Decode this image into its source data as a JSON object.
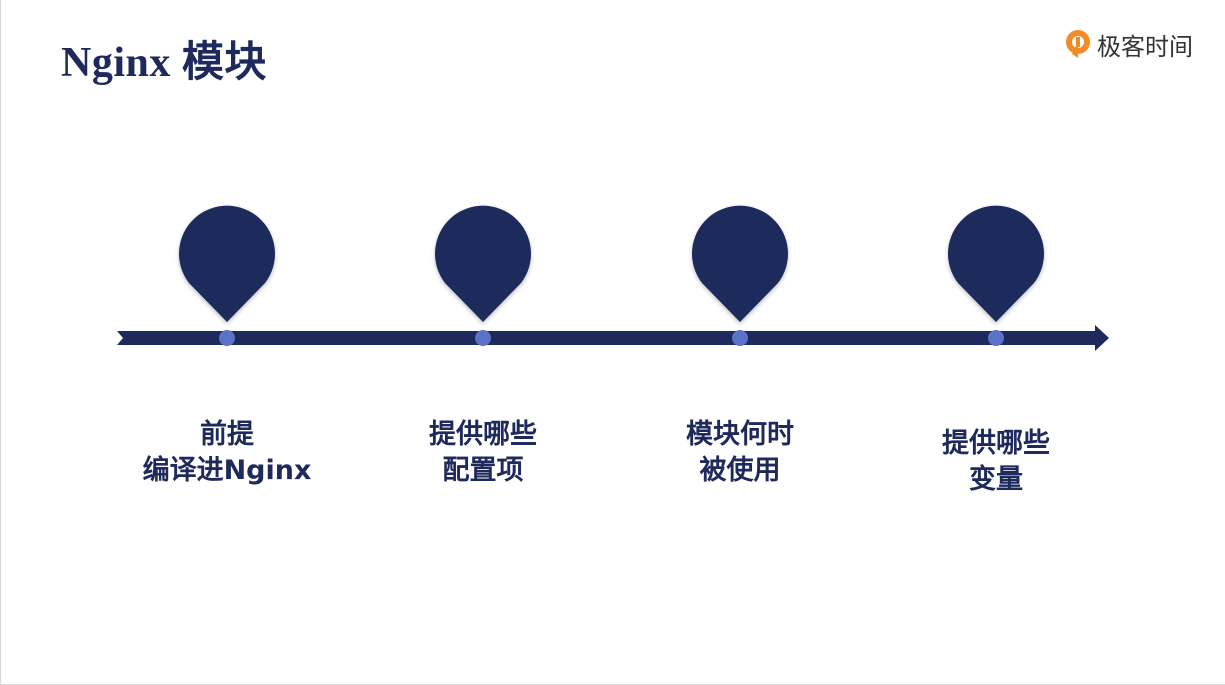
{
  "slide": {
    "title": "Nginx 模块",
    "brand": {
      "name": "极客时间",
      "logo_icon": "geektime-logo-icon",
      "logo_color": "#f28c28"
    }
  },
  "colors": {
    "primary": "#1f2a5c",
    "dot": "#5b73c7"
  },
  "timeline": {
    "milestones": [
      {
        "line1": "前提",
        "line2": "编译进Nginx"
      },
      {
        "line1": "提供哪些",
        "line2": "配置项"
      },
      {
        "line1": "模块何时",
        "line2": "被使用"
      },
      {
        "line1": "提供哪些",
        "line2": "变量"
      }
    ]
  }
}
